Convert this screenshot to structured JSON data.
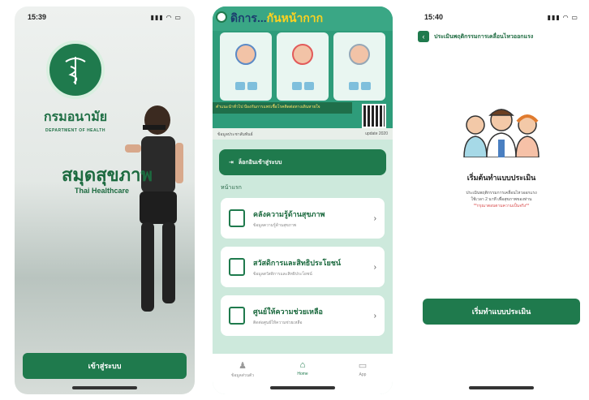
{
  "screen1": {
    "time": "15:39",
    "status_icons": "▮▮▮ ◠ ▭",
    "dept_thai": "กรมอนามัย",
    "dept_en": "DEPARTMENT OF HEALTH",
    "app_title": "สมุดสุขภาพ",
    "app_subtitle": "Thai Healthcare",
    "login_label": "เข้าสู่ระบบ"
  },
  "screen2": {
    "banner_title_a": "ดิการ...",
    "banner_title_b": "กันหน้ากาก",
    "notice": "คำแนะนำทั่วไป ป้องกันการแพร่เชื้อโรคติดต่อทางเดินหายใจ",
    "info_left": "ข้อมูลประชาสัมพันธ์",
    "info_right": "update 2020",
    "menu_button": "ล็อกอินเข้าสู่ระบบ",
    "section": "หน้าแรก",
    "cards": [
      {
        "title": "คลังความรู้ด้านสุขภาพ",
        "sub": "ข้อมูลความรู้ด้านสุขภาพ"
      },
      {
        "title": "สวัสดิการและสิทธิประโยชน์",
        "sub": "ข้อมูลสวัสดิการและสิทธิประโยชน์"
      },
      {
        "title": "ศูนย์ให้ความช่วยเหลือ",
        "sub": "ติดต่อศูนย์ให้ความช่วยเหลือ"
      }
    ],
    "tabs": [
      {
        "label": "ข้อมูลส่วนตัว",
        "icon": "person-icon"
      },
      {
        "label": "Home",
        "icon": "home-icon"
      },
      {
        "label": "App",
        "icon": "app-icon"
      }
    ]
  },
  "screen3": {
    "time": "15:40",
    "status_icons": "▮▮▮ ◠ ▭",
    "nav_title": "ประเมินพฤติกรรมการเคลื่อนไหวออกแรง",
    "start_title": "เริ่มต้นทำแบบประเมิน",
    "desc": "ประเมินพฤติกรรมการเคลื่อนไหวออกแรง",
    "desc2": "ใช้เวลา 2 นาที เพื่อสุขภาพของท่าน",
    "warning": "**กรุณาตอบตามความเป็นจริง**",
    "button": "เริ่มทำแบบประเมิน"
  },
  "colors": {
    "brand_green": "#1f7a4d",
    "teal": "#2e9c7a",
    "light_mint": "#cde9dc"
  }
}
